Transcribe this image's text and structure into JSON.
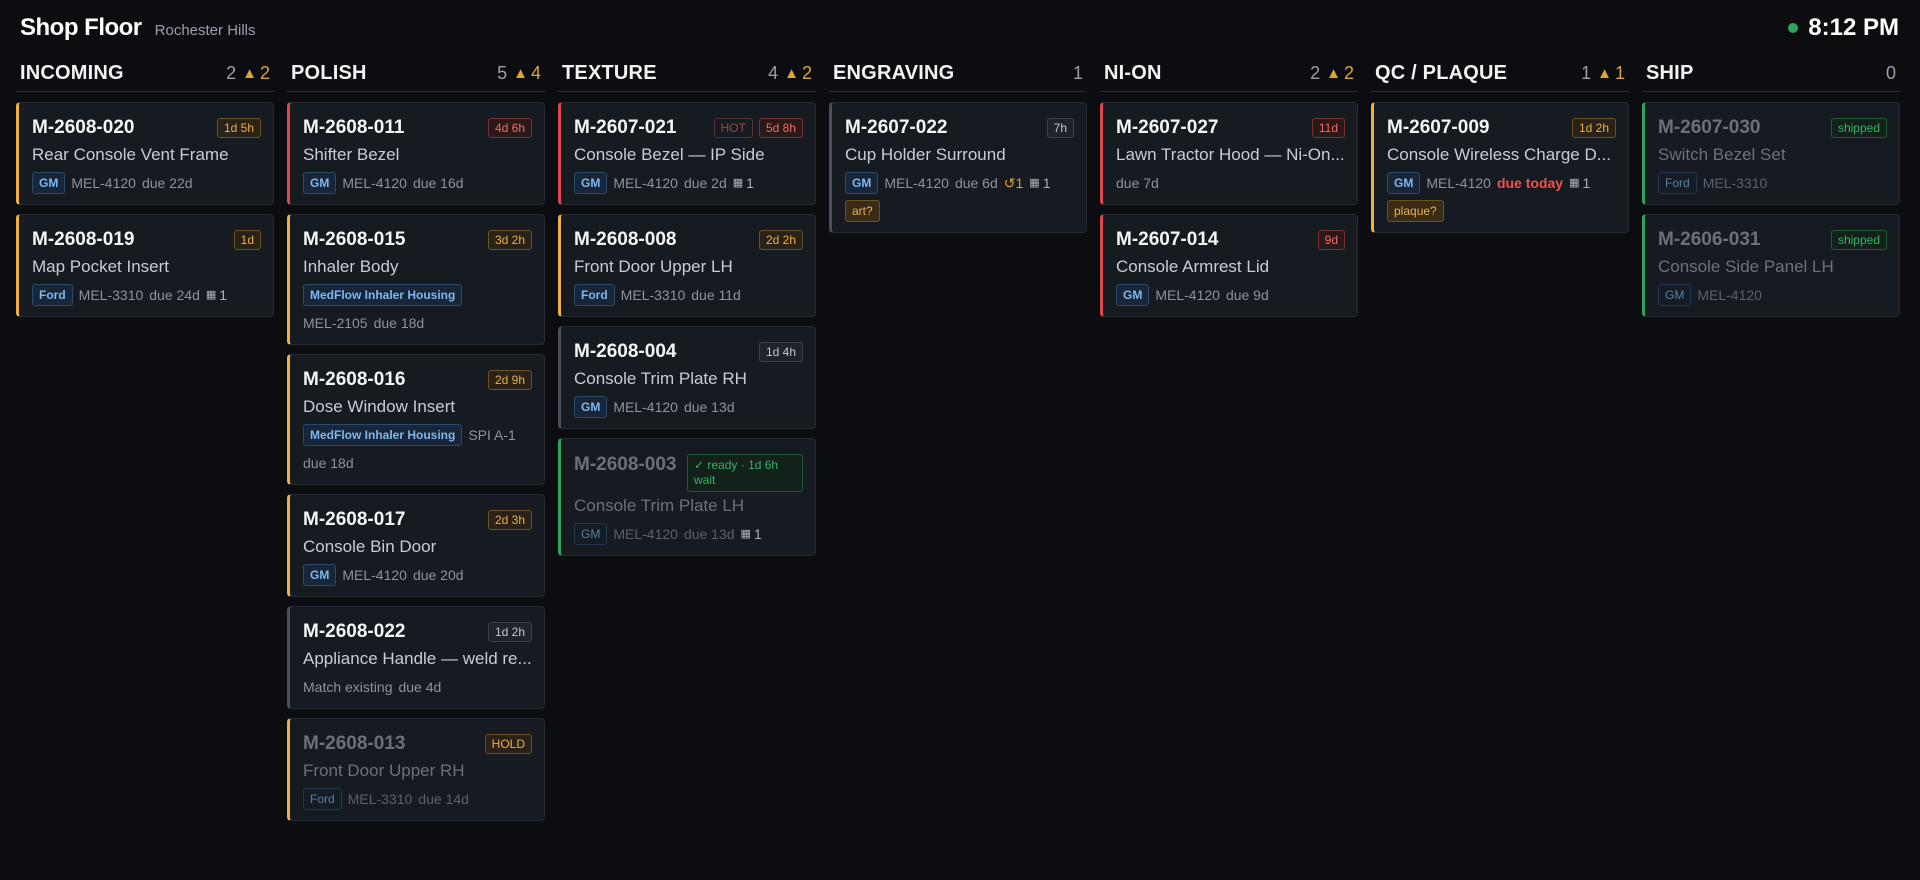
{
  "header": {
    "title": "Shop Floor",
    "location": "Rochester Hills",
    "time": "8:12 PM"
  },
  "columns": [
    {
      "title": "INCOMING",
      "count": "2",
      "warn": "2"
    },
    {
      "title": "POLISH",
      "count": "5",
      "warn": "4"
    },
    {
      "title": "TEXTURE",
      "count": "4",
      "warn": "2"
    },
    {
      "title": "ENGRAVING",
      "count": "1",
      "warn": ""
    },
    {
      "title": "NI-ON",
      "count": "2",
      "warn": "2"
    },
    {
      "title": "QC / PLAQUE",
      "count": "1",
      "warn": "1"
    },
    {
      "title": "SHIP",
      "count": "0",
      "warn": ""
    }
  ],
  "cards": {
    "c0_0": {
      "id": "M-2608-020",
      "badge": "1d 5h",
      "name": "Rear Console Vent Frame",
      "tag": "GM",
      "part": "MEL-4120",
      "due": "due 22d"
    },
    "c0_1": {
      "id": "M-2608-019",
      "badge": "1d",
      "name": "Map Pocket Insert",
      "tag": "Ford",
      "part": "MEL-3310",
      "due": "due 24d",
      "att": "1"
    },
    "c1_0": {
      "id": "M-2608-011",
      "badge": "4d 6h",
      "name": "Shifter Bezel",
      "tag": "GM",
      "part": "MEL-4120",
      "due": "due 16d"
    },
    "c1_1": {
      "id": "M-2608-015",
      "badge": "3d 2h",
      "name": "Inhaler Body",
      "tag": "MedFlow Inhaler Housing",
      "part": "MEL-2105",
      "due": "due 18d"
    },
    "c1_2": {
      "id": "M-2608-016",
      "badge": "2d 9h",
      "name": "Dose Window Insert",
      "tag": "MedFlow Inhaler Housing",
      "part": "SPI A-1",
      "due": "due 18d"
    },
    "c1_3": {
      "id": "M-2608-017",
      "badge": "2d 3h",
      "name": "Console Bin Door",
      "tag": "GM",
      "part": "MEL-4120",
      "due": "due 20d"
    },
    "c1_4": {
      "id": "M-2608-022",
      "badge": "1d 2h",
      "name": "Appliance Handle — weld re...",
      "part": "Match existing",
      "due": "due 4d"
    },
    "c1_5": {
      "id": "M-2608-013",
      "badge": "HOLD",
      "name": "Front Door Upper RH",
      "tag": "Ford",
      "part": "MEL-3310",
      "due": "due 14d"
    },
    "c2_0": {
      "id": "M-2607-021",
      "hot": "HOT",
      "badge": "5d 8h",
      "name": "Console Bezel — IP Side",
      "tag": "GM",
      "part": "MEL-4120",
      "due": "due 2d",
      "att": "1"
    },
    "c2_1": {
      "id": "M-2608-008",
      "badge": "2d 2h",
      "name": "Front Door Upper LH",
      "tag": "Ford",
      "part": "MEL-3310",
      "due": "due 11d"
    },
    "c2_2": {
      "id": "M-2608-004",
      "badge": "1d 4h",
      "name": "Console Trim Plate RH",
      "tag": "GM",
      "part": "MEL-4120",
      "due": "due 13d"
    },
    "c2_3": {
      "id": "M-2608-003",
      "badge": "✓ ready · 1d 6h wait",
      "name": "Console Trim Plate LH",
      "tag": "GM",
      "part": "MEL-4120",
      "due": "due 13d",
      "att": "1"
    },
    "c3_0": {
      "id": "M-2607-022",
      "badge": "7h",
      "name": "Cup Holder Surround",
      "tag": "GM",
      "part": "MEL-4120",
      "due": "due 6d",
      "redo": "↺1",
      "att": "1",
      "flag": "art?"
    },
    "c4_0": {
      "id": "M-2607-027",
      "badge": "11d",
      "name": "Lawn Tractor Hood — Ni-On...",
      "due": "due 7d"
    },
    "c4_1": {
      "id": "M-2607-014",
      "badge": "9d",
      "name": "Console Armrest Lid",
      "tag": "GM",
      "part": "MEL-4120",
      "due": "due 9d"
    },
    "c5_0": {
      "id": "M-2607-009",
      "badge": "1d 2h",
      "name": "Console Wireless Charge D...",
      "tag": "GM",
      "part": "MEL-4120",
      "due": "due today",
      "att": "1",
      "flag": "plaque?"
    },
    "c6_0": {
      "id": "M-2607-030",
      "badge": "shipped",
      "name": "Switch Bezel Set",
      "tag": "Ford",
      "part": "MEL-3310"
    },
    "c6_1": {
      "id": "M-2606-031",
      "badge": "shipped",
      "name": "Console Side Panel LH",
      "tag": "GM",
      "part": "MEL-4120"
    }
  },
  "icons": {
    "warn": "warning-triangle-icon",
    "attachment": "film-icon",
    "redo": "redo-icon"
  },
  "colors": {
    "warn": "#f0b13c",
    "danger": "#e0474a",
    "ok": "#2fa35c",
    "background": "#0b0d11"
  }
}
